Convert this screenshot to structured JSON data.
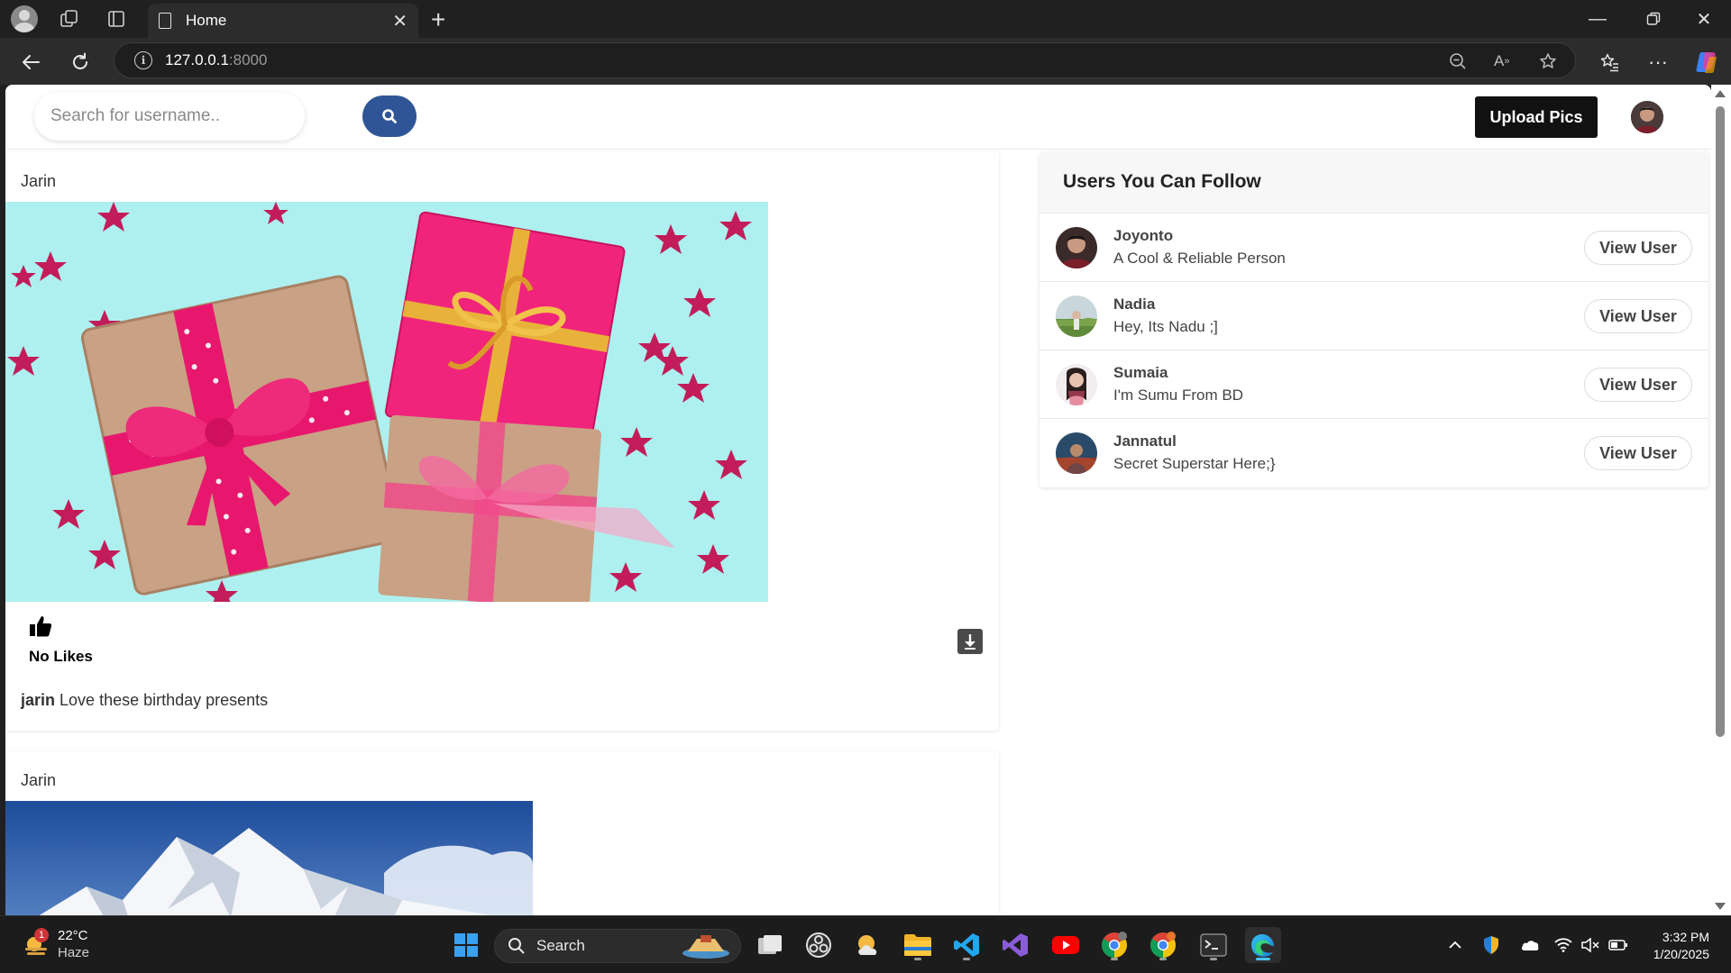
{
  "browser": {
    "tab_title": "Home",
    "url_host": "127.0.0.1",
    "url_port": ":8000"
  },
  "topnav": {
    "search_placeholder": "Search for username..",
    "upload_label": "Upload Pics"
  },
  "posts": [
    {
      "author": "Jarin",
      "likes_text": "No Likes",
      "caption_user": "jarin",
      "caption_text": "Love these birthday presents"
    },
    {
      "author": "Jarin"
    }
  ],
  "suggestions": {
    "title": "Users You Can Follow",
    "button_label": "View User",
    "users": [
      {
        "name": "Joyonto",
        "bio": "A Cool & Reliable Person"
      },
      {
        "name": "Nadia",
        "bio": "Hey, Its Nadu ;]"
      },
      {
        "name": "Sumaia",
        "bio": "I'm Sumu From BD"
      },
      {
        "name": "Jannatul",
        "bio": "Secret Superstar Here;}"
      }
    ]
  },
  "taskbar": {
    "temperature": "22°C",
    "condition": "Haze",
    "weather_badge": "1",
    "search_label": "Search",
    "time": "3:32 PM",
    "date": "1/20/2025"
  },
  "colors": {
    "search_button": "#2f5596",
    "upload_button": "#111111",
    "gift_background": "#aef0ef",
    "gift_pink": "#e8176e"
  }
}
